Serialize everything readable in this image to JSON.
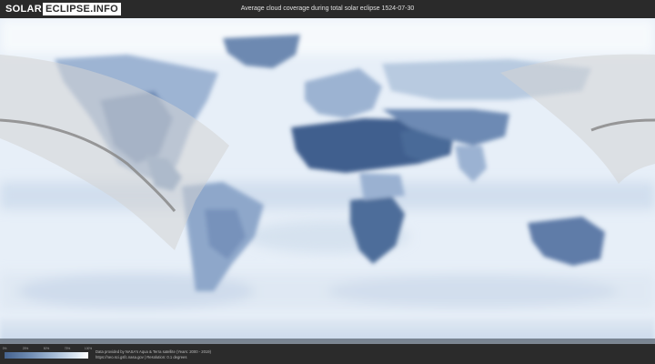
{
  "header": {
    "logo_solar": "SOLAR",
    "logo_eclipse": "ECLIPSE.INFO",
    "title": "Average cloud coverage during total solar eclipse 1524-07-30"
  },
  "map": {
    "description_icon": "world-cloud-coverage-map",
    "colors": {
      "ocean_light": "#e9f1f9",
      "cloud_dark": "#3f5f8e",
      "cloud_mid": "#7f9cc2",
      "eclipse_band": "#d8d8d8",
      "central_line": "#8a8a8a"
    }
  },
  "legend": {
    "ticks": [
      "0%",
      "25%",
      "50%",
      "75%",
      "100%"
    ],
    "tick_positions": [
      0,
      0.25,
      0.5,
      0.75,
      1.0
    ]
  },
  "footer": {
    "credit_line1": "Data provided by NASA's Aqua & Terra satellite (Years: 2000 - 2019)",
    "credit_line2": "https://neo.sci.gsfc.nasa.gov | Resolution: 0.1 degrees"
  }
}
